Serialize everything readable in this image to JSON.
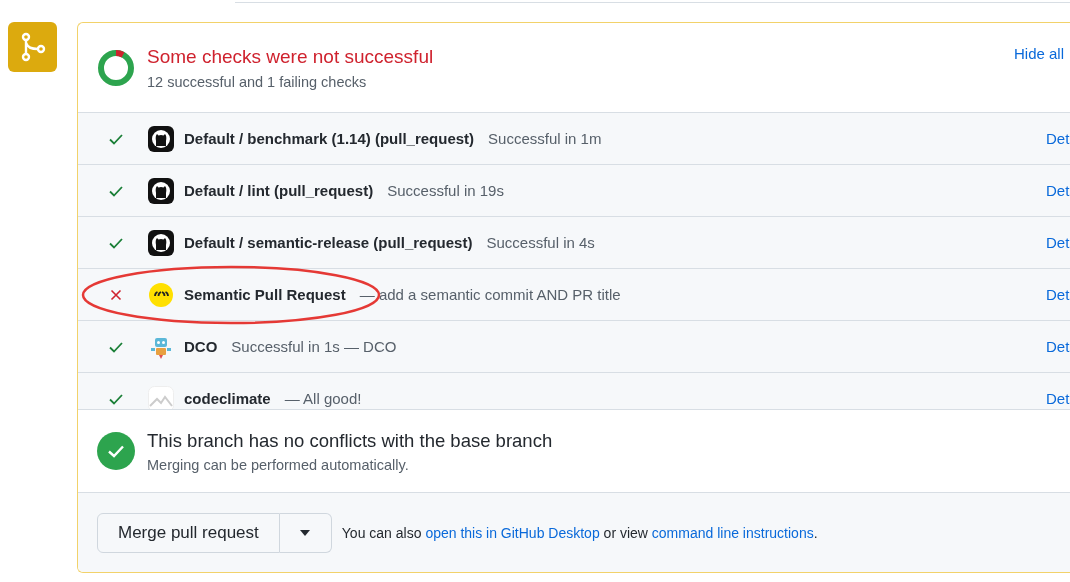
{
  "status_header": {
    "title": "Some checks were not successful",
    "summary": "12 successful and 1 failing checks",
    "toggle": "Hide all"
  },
  "checks": [
    {
      "passed": true,
      "kind": "github",
      "name": "Default / benchmark (1.14) (pull_request)",
      "description": "Successful in 1m",
      "details": "Det",
      "circled": false
    },
    {
      "passed": true,
      "kind": "github",
      "name": "Default / lint (pull_request)",
      "description": "Successful in 19s",
      "details": "Det",
      "circled": false
    },
    {
      "passed": true,
      "kind": "github",
      "name": "Default / semantic-release (pull_request)",
      "description": "Successful in 4s",
      "details": "Det",
      "circled": false
    },
    {
      "passed": false,
      "kind": "semantic",
      "name": "Semantic Pull Request",
      "description": "— add a semantic commit AND PR title",
      "details": "Det",
      "circled": true
    },
    {
      "passed": true,
      "kind": "robot",
      "name": "DCO",
      "description": "Successful in 1s — DCO",
      "details": "Det",
      "circled": false
    },
    {
      "passed": true,
      "kind": "codeclimate",
      "name": "codeclimate",
      "description": "— All good!",
      "details": "Det",
      "circled": false
    }
  ],
  "merge_status": {
    "title": "This branch has no conflicts with the base branch",
    "subtitle": "Merging can be performed automatically."
  },
  "merge_footer": {
    "button": "Merge pull request",
    "hint_before": "You can also",
    "link_desktop": "open this in GitHub Desktop",
    "hint_middle": "or view",
    "link_cli": "command line instructions",
    "hint_end": "."
  }
}
